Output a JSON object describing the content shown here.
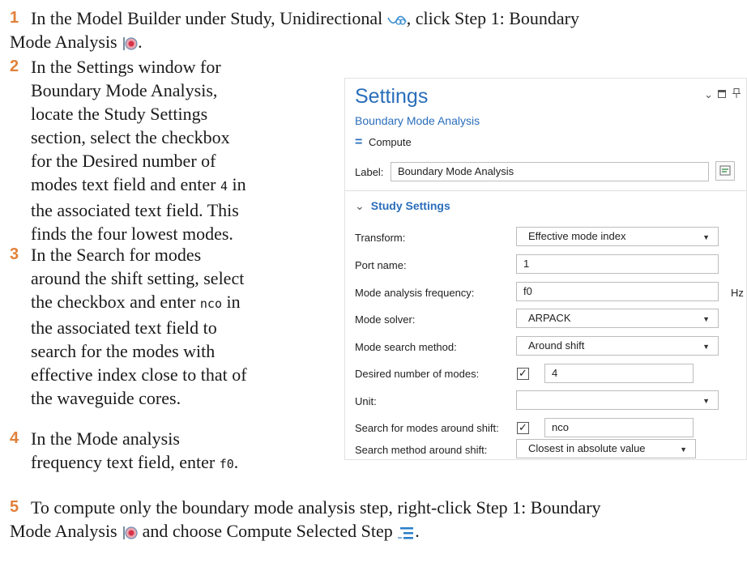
{
  "steps": [
    {
      "num": "1",
      "a": "In the Model Builder under Study, Unidirectional",
      "b": ", click Step 1: Boundary",
      "c": "Mode Analysis",
      "d": "."
    },
    {
      "num": "2",
      "lines": [
        "In the Settings window for",
        "Boundary Mode Analysis,",
        "locate the Study Settings",
        "section, select the checkbox",
        "for the Desired number of"
      ],
      "l6a": "modes text field and enter ",
      "l6code": "4",
      "l6b": " in",
      "l7": "the associated text field. This",
      "l8": "finds the four lowest modes."
    },
    {
      "num": "3",
      "l1": "In the Search for modes",
      "l2": "around the shift setting, select",
      "l3a": "the checkbox and enter ",
      "l3code": "nco",
      "l3b": " in",
      "lines": [
        "the associated text field to",
        "search for the modes with",
        "effective index close to that of",
        "the waveguide cores."
      ]
    },
    {
      "num": "4",
      "l1": "In the Mode analysis",
      "l2a": "frequency text field, enter ",
      "l2code": "f0",
      "l2b": "."
    },
    {
      "num": "5",
      "l1": "To compute only the boundary mode analysis step, right-click Step 1: Boundary",
      "l2a": "Mode Analysis",
      "l2b": "and choose Compute Selected Step",
      "l2c": "."
    }
  ],
  "panel": {
    "title": "Settings",
    "subtitle": "Boundary Mode Analysis",
    "compute_label": "Compute",
    "label_caption": "Label:",
    "label_value": "Boundary Mode Analysis",
    "section_title": "Study Settings",
    "rows": {
      "transform": {
        "label": "Transform:",
        "value": "Effective mode index"
      },
      "port_name": {
        "label": "Port name:",
        "value": "1"
      },
      "mode_freq": {
        "label": "Mode analysis frequency:",
        "value": "f0",
        "unit": "Hz"
      },
      "mode_solver": {
        "label": "Mode solver:",
        "value": "ARPACK"
      },
      "search_method": {
        "label": "Mode search method:",
        "value": "Around shift"
      },
      "desired_modes": {
        "label": "Desired number of modes:",
        "checked": true,
        "value": "4"
      },
      "unit": {
        "label": "Unit:",
        "value": ""
      },
      "search_shift": {
        "label": "Search for modes around shift:",
        "checked": true,
        "value": "nco"
      },
      "search_method_shift": {
        "label": "Search method around shift:",
        "value": "Closest in absolute value"
      }
    }
  },
  "icons": [
    "unidirectional-study-icon",
    "boundary-mode-analysis-icon",
    "compute-selected-step-icon",
    "chevron-down-icon",
    "maximize-icon",
    "pin-icon",
    "equals-icon",
    "checkbox-check-icon"
  ],
  "colors": {
    "step_number": "#e0813b",
    "panel_accent": "#2a6ebb"
  }
}
